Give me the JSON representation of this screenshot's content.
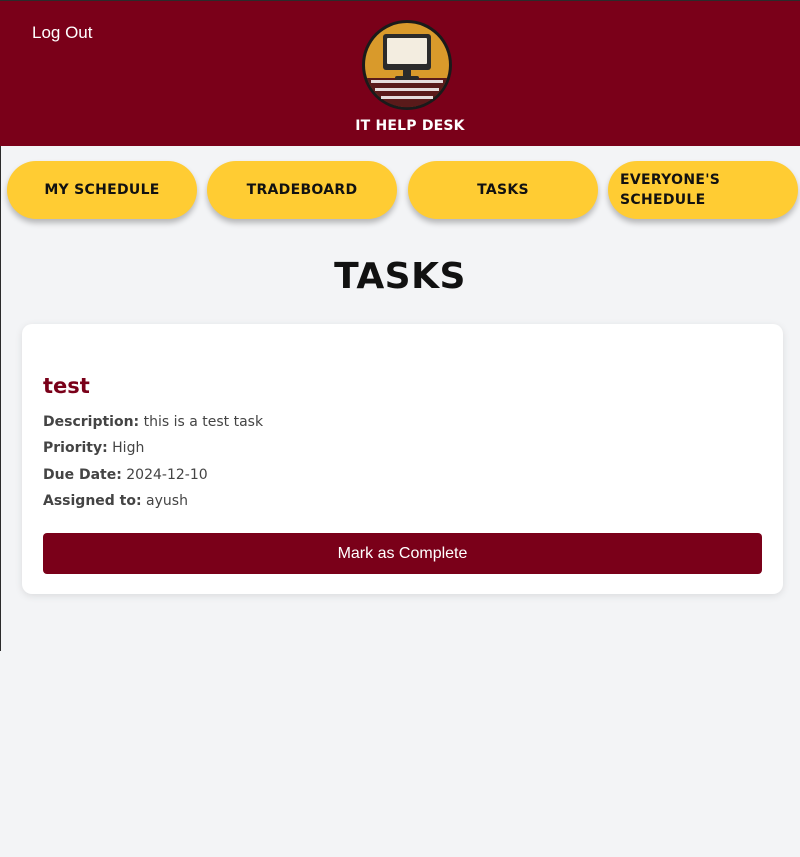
{
  "header": {
    "logout_label": "Log Out",
    "logo_text": "IT HELP DESK",
    "logo_icon": "computer-monitor-icon",
    "background_color": "#7a0019"
  },
  "nav": {
    "items": [
      {
        "label": "MY SCHEDULE"
      },
      {
        "label": "TRADEBOARD"
      },
      {
        "label": "TASKS"
      },
      {
        "label_line1": "EVERYONE'S",
        "label_line2": "SCHEDULE"
      }
    ],
    "button_color": "#ffcc33"
  },
  "main": {
    "title": "TASKS",
    "task": {
      "name": "test",
      "description_label": "Description:",
      "description": "this is a test task",
      "priority_label": "Priority:",
      "priority": "High",
      "due_label": "Due Date:",
      "due": "2024-12-10",
      "assigned_label": "Assigned to:",
      "assigned": "ayush",
      "complete_label": "Mark as Complete"
    }
  }
}
